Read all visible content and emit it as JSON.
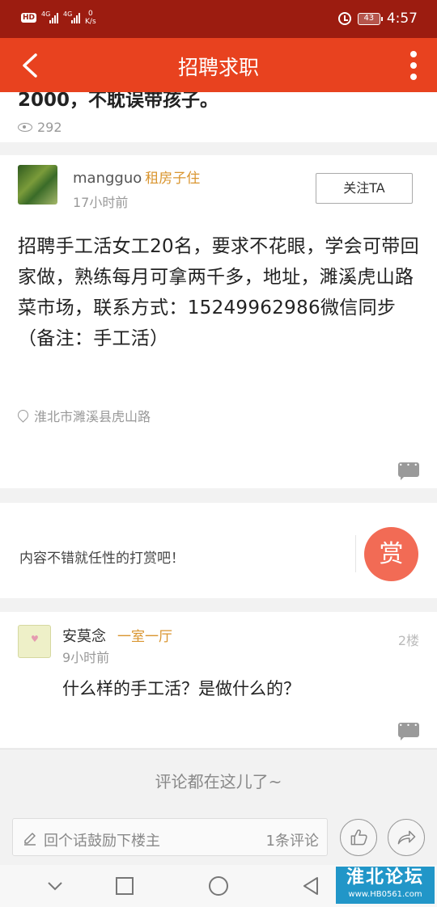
{
  "status_bar": {
    "hd": "HD",
    "net1": "4G",
    "net2": "4G",
    "speed_value": "0",
    "speed_unit": "K/s",
    "battery": "43",
    "time": "4:57"
  },
  "app_bar": {
    "title": "招聘求职"
  },
  "previous_post": {
    "text_tail": "2000，不耽误带孩子。",
    "views": "292"
  },
  "post": {
    "username": "mangguo",
    "user_tag": "租房子住",
    "time": "17小时前",
    "follow_label": "关注TA",
    "body": "招聘手工活女工20名，要求不花眼，学会可带回家做，熟练每月可拿两千多，地址，濉溪虎山路菜市场，联系方式：15249962986微信同步（备注：手工活）",
    "location": "淮北市濉溪县虎山路"
  },
  "tip": {
    "text": "内容不错就任性的打赏吧！",
    "button_label": "赏"
  },
  "reply": {
    "username": "安莫念",
    "user_tag": "一室一厅",
    "time": "9小时前",
    "floor": "2楼",
    "body": "什么样的手工活？是做什么的？"
  },
  "end_note": "评论都在这儿了~",
  "bottom_bar": {
    "placeholder": "回个话鼓励下楼主",
    "comment_count": "1条评论"
  },
  "watermark": {
    "title": "淮北论坛",
    "url": "www.HB0561.com"
  },
  "colors": {
    "status_bar": "#9c1c10",
    "app_bar": "#e8421f",
    "tag": "#d9952f",
    "tip_button": "#f26b55",
    "watermark": "#2196c8"
  }
}
